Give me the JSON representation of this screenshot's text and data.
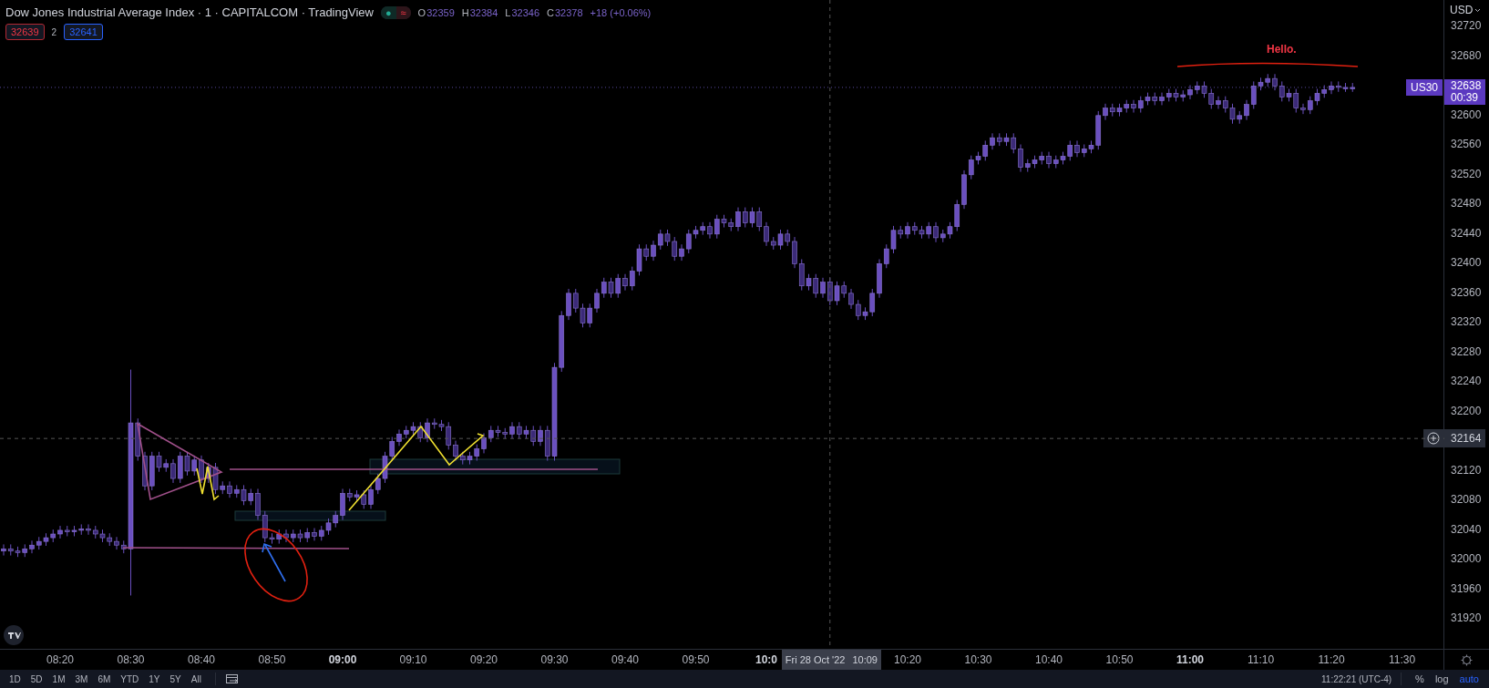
{
  "legend": {
    "title": "Dow Jones Industrial Average Index · 1 · CAPITALCOM · TradingView",
    "status_dot": "●",
    "status_glyph": "≈",
    "ohlc": [
      {
        "key": "O",
        "value": "32359"
      },
      {
        "key": "H",
        "value": "32384"
      },
      {
        "key": "L",
        "value": "32346"
      },
      {
        "key": "C",
        "value": "32378"
      }
    ],
    "change": "+18 (+0.06%)",
    "sell": "32639",
    "spread": "2",
    "buy": "32641"
  },
  "chart": {
    "currency": "USD",
    "chart_data": {
      "type": "candlestick",
      "categories": [
        null,
        null,
        null,
        null,
        null,
        null,
        null,
        null,
        "08:20",
        null,
        null,
        null,
        null,
        null,
        null,
        null,
        null,
        null,
        "08:30",
        null,
        null,
        null,
        null,
        null,
        null,
        null,
        null,
        null,
        "08:40",
        null,
        null,
        null,
        null,
        null,
        null,
        null,
        null,
        null,
        "08:50",
        null,
        null,
        null,
        null,
        null,
        null,
        null,
        null,
        null,
        "09:00",
        null,
        null,
        null,
        null,
        null,
        null,
        null,
        null,
        null,
        "09:10",
        null,
        null,
        null,
        null,
        null,
        null,
        null,
        null,
        null,
        "09:20",
        null,
        null,
        null,
        null,
        null,
        null,
        null,
        null,
        null,
        "09:30",
        null,
        null,
        null,
        null,
        null,
        null,
        null,
        null,
        null,
        "09:40",
        null,
        null,
        null,
        null,
        null,
        null,
        null,
        null,
        null,
        "09:50",
        null,
        null,
        null,
        null,
        null,
        null,
        null,
        null,
        null,
        "10:0",
        null,
        null,
        null,
        null,
        null,
        null,
        null,
        null,
        null,
        null,
        null,
        null,
        null,
        null,
        null,
        null,
        null,
        null,
        null,
        "10:20",
        null,
        null,
        null,
        null,
        null,
        null,
        null,
        null,
        null,
        "10:30",
        null,
        null,
        null,
        null,
        null,
        null,
        null,
        null,
        null,
        "10:40",
        null,
        null,
        null,
        null,
        null,
        null,
        null,
        null,
        null,
        "10:50",
        null,
        null,
        null,
        null,
        null,
        null,
        null,
        null,
        null,
        "11:00",
        null,
        null,
        null,
        null,
        null,
        null,
        null,
        null,
        null,
        "11:10",
        null,
        null,
        null,
        null,
        null,
        null,
        null,
        null,
        null,
        "11:20",
        null,
        null,
        null,
        null,
        null,
        null,
        null,
        null,
        null,
        "11:30"
      ],
      "ohlc": [
        [
          32012,
          32021,
          32006,
          32015
        ],
        [
          32015,
          32021,
          32006,
          32012
        ],
        [
          32012,
          32018,
          32004,
          32010
        ],
        [
          32010,
          32021,
          32004,
          32015
        ],
        [
          32015,
          32026,
          32009,
          32020
        ],
        [
          32020,
          32031,
          32014,
          32025
        ],
        [
          32025,
          32036,
          32019,
          32030
        ],
        [
          32030,
          32041,
          32024,
          32035
        ],
        [
          32035,
          32046,
          32029,
          32040
        ],
        [
          32040,
          32046,
          32032,
          32038
        ],
        [
          32038,
          32046,
          32032,
          32040
        ],
        [
          32040,
          32048,
          32034,
          32042
        ],
        [
          32042,
          32048,
          32034,
          32040
        ],
        [
          32040,
          32046,
          32029,
          32035
        ],
        [
          32035,
          32041,
          32024,
          32030
        ],
        [
          32030,
          32036,
          32019,
          32025
        ],
        [
          32025,
          32031,
          32014,
          32020
        ],
        [
          32020,
          32026,
          32009,
          32015
        ],
        [
          32015,
          32257,
          31952,
          32185
        ],
        [
          32185,
          32191,
          32134,
          32140
        ],
        [
          32140,
          32146,
          32094,
          32100
        ],
        [
          32100,
          32146,
          32094,
          32140
        ],
        [
          32140,
          32146,
          32119,
          32125
        ],
        [
          32125,
          32136,
          32119,
          32130
        ],
        [
          32130,
          32136,
          32104,
          32110
        ],
        [
          32110,
          32146,
          32104,
          32140
        ],
        [
          32140,
          32146,
          32114,
          32120
        ],
        [
          32120,
          32141,
          32114,
          32135
        ],
        [
          32135,
          32141,
          32104,
          32110
        ],
        [
          32110,
          32131,
          32104,
          32125
        ],
        [
          32125,
          32131,
          32089,
          32095
        ],
        [
          32095,
          32106,
          32089,
          32100
        ],
        [
          32100,
          32106,
          32084,
          32090
        ],
        [
          32090,
          32101,
          32084,
          32095
        ],
        [
          32095,
          32101,
          32074,
          32080
        ],
        [
          32080,
          32096,
          32074,
          32090
        ],
        [
          32090,
          32096,
          32054,
          32060
        ],
        [
          32060,
          32066,
          32024,
          32030
        ],
        [
          32030,
          32036,
          32022,
          32028
        ],
        [
          32028,
          32041,
          32022,
          32035
        ],
        [
          32035,
          32041,
          32024,
          32030
        ],
        [
          32030,
          32041,
          32024,
          32035
        ],
        [
          32035,
          32041,
          32024,
          32030
        ],
        [
          32030,
          32043,
          32024,
          32037
        ],
        [
          32037,
          32043,
          32026,
          32032
        ],
        [
          32032,
          32046,
          32026,
          32040
        ],
        [
          32040,
          32056,
          32034,
          32050
        ],
        [
          32050,
          32066,
          32044,
          32060
        ],
        [
          32060,
          32096,
          32054,
          32090
        ],
        [
          32090,
          32096,
          32079,
          32085
        ],
        [
          32085,
          32094,
          32079,
          32088
        ],
        [
          32088,
          32094,
          32069,
          32075
        ],
        [
          32075,
          32101,
          32069,
          32095
        ],
        [
          32095,
          32116,
          32089,
          32110
        ],
        [
          32110,
          32146,
          32104,
          32140
        ],
        [
          32140,
          32166,
          32134,
          32160
        ],
        [
          32160,
          32176,
          32154,
          32170
        ],
        [
          32170,
          32181,
          32164,
          32175
        ],
        [
          32175,
          32186,
          32169,
          32180
        ],
        [
          32180,
          32186,
          32159,
          32165
        ],
        [
          32165,
          32191,
          32159,
          32185
        ],
        [
          32185,
          32191,
          32177,
          32183
        ],
        [
          32183,
          32189,
          32174,
          32180
        ],
        [
          32180,
          32186,
          32149,
          32155
        ],
        [
          32155,
          32161,
          32134,
          32140
        ],
        [
          32140,
          32146,
          32129,
          32135
        ],
        [
          32135,
          32146,
          32129,
          32140
        ],
        [
          32140,
          32156,
          32134,
          32150
        ],
        [
          32150,
          32171,
          32144,
          32165
        ],
        [
          32165,
          32181,
          32159,
          32175
        ],
        [
          32175,
          32181,
          32166,
          32172
        ],
        [
          32172,
          32178,
          32164,
          32170
        ],
        [
          32170,
          32186,
          32164,
          32180
        ],
        [
          32180,
          32186,
          32164,
          32170
        ],
        [
          32170,
          32181,
          32164,
          32175
        ],
        [
          32175,
          32181,
          32154,
          32160
        ],
        [
          32160,
          32181,
          32154,
          32175
        ],
        [
          32175,
          32181,
          32134,
          32140
        ],
        [
          32140,
          32266,
          32134,
          32260
        ],
        [
          32260,
          32336,
          32254,
          32330
        ],
        [
          32330,
          32366,
          32324,
          32360
        ],
        [
          32360,
          32366,
          32334,
          32340
        ],
        [
          32340,
          32346,
          32314,
          32320
        ],
        [
          32320,
          32346,
          32314,
          32340
        ],
        [
          32340,
          32366,
          32334,
          32360
        ],
        [
          32360,
          32381,
          32354,
          32375
        ],
        [
          32375,
          32381,
          32354,
          32360
        ],
        [
          32360,
          32386,
          32354,
          32380
        ],
        [
          32380,
          32386,
          32364,
          32370
        ],
        [
          32370,
          32396,
          32364,
          32390
        ],
        [
          32390,
          32426,
          32384,
          32420
        ],
        [
          32420,
          32426,
          32404,
          32410
        ],
        [
          32410,
          32431,
          32404,
          32425
        ],
        [
          32425,
          32446,
          32419,
          32440
        ],
        [
          32440,
          32446,
          32424,
          32430
        ],
        [
          32430,
          32436,
          32404,
          32410
        ],
        [
          32410,
          32426,
          32404,
          32420
        ],
        [
          32420,
          32446,
          32414,
          32440
        ],
        [
          32440,
          32451,
          32434,
          32445
        ],
        [
          32445,
          32456,
          32439,
          32450
        ],
        [
          32450,
          32456,
          32434,
          32440
        ],
        [
          32440,
          32466,
          32434,
          32460
        ],
        [
          32460,
          32466,
          32449,
          32455
        ],
        [
          32455,
          32461,
          32444,
          32450
        ],
        [
          32450,
          32476,
          32444,
          32470
        ],
        [
          32470,
          32476,
          32449,
          32455
        ],
        [
          32455,
          32476,
          32449,
          32470
        ],
        [
          32470,
          32476,
          32444,
          32450
        ],
        [
          32450,
          32456,
          32424,
          32430
        ],
        [
          32430,
          32436,
          32419,
          32425
        ],
        [
          32425,
          32446,
          32419,
          32440
        ],
        [
          32440,
          32446,
          32424,
          32430
        ],
        [
          32430,
          32436,
          32394,
          32400
        ],
        [
          32400,
          32406,
          32364,
          32370
        ],
        [
          32370,
          32386,
          32364,
          32380
        ],
        [
          32380,
          32386,
          32354,
          32360
        ],
        [
          32360,
          32381,
          32354,
          32375
        ],
        [
          32375,
          32381,
          32344,
          32350
        ],
        [
          32350,
          32376,
          32344,
          32370
        ],
        [
          32370,
          32376,
          32354,
          32360
        ],
        [
          32360,
          32366,
          32339,
          32345
        ],
        [
          32345,
          32351,
          32324,
          32330
        ],
        [
          32330,
          32341,
          32324,
          32335
        ],
        [
          32335,
          32366,
          32329,
          32360
        ],
        [
          32360,
          32406,
          32354,
          32400
        ],
        [
          32400,
          32426,
          32394,
          32420
        ],
        [
          32420,
          32451,
          32414,
          32445
        ],
        [
          32445,
          32451,
          32434,
          32440
        ],
        [
          32440,
          32456,
          32434,
          32450
        ],
        [
          32450,
          32456,
          32439,
          32445
        ],
        [
          32445,
          32451,
          32434,
          32440
        ],
        [
          32440,
          32456,
          32434,
          32450
        ],
        [
          32450,
          32456,
          32429,
          32435
        ],
        [
          32435,
          32446,
          32429,
          32440
        ],
        [
          32440,
          32456,
          32434,
          32450
        ],
        [
          32450,
          32486,
          32444,
          32480
        ],
        [
          32480,
          32526,
          32474,
          32520
        ],
        [
          32520,
          32546,
          32514,
          32540
        ],
        [
          32540,
          32551,
          32534,
          32545
        ],
        [
          32545,
          32566,
          32539,
          32560
        ],
        [
          32560,
          32576,
          32554,
          32570
        ],
        [
          32570,
          32576,
          32559,
          32565
        ],
        [
          32565,
          32576,
          32559,
          32570
        ],
        [
          32570,
          32576,
          32549,
          32555
        ],
        [
          32555,
          32561,
          32524,
          32530
        ],
        [
          32530,
          32541,
          32524,
          32535
        ],
        [
          32535,
          32546,
          32529,
          32540
        ],
        [
          32540,
          32551,
          32534,
          32545
        ],
        [
          32545,
          32551,
          32529,
          32535
        ],
        [
          32535,
          32546,
          32529,
          32540
        ],
        [
          32540,
          32551,
          32534,
          32545
        ],
        [
          32545,
          32566,
          32539,
          32560
        ],
        [
          32560,
          32566,
          32544,
          32550
        ],
        [
          32550,
          32561,
          32544,
          32555
        ],
        [
          32555,
          32566,
          32549,
          32560
        ],
        [
          32560,
          32606,
          32554,
          32600
        ],
        [
          32600,
          32616,
          32594,
          32610
        ],
        [
          32610,
          32616,
          32599,
          32605
        ],
        [
          32605,
          32616,
          32599,
          32610
        ],
        [
          32610,
          32621,
          32604,
          32615
        ],
        [
          32615,
          32621,
          32604,
          32610
        ],
        [
          32610,
          32626,
          32604,
          32620
        ],
        [
          32620,
          32631,
          32614,
          32625
        ],
        [
          32625,
          32631,
          32614,
          32620
        ],
        [
          32620,
          32631,
          32614,
          32625
        ],
        [
          32625,
          32636,
          32619,
          32630
        ],
        [
          32630,
          32636,
          32619,
          32625
        ],
        [
          32625,
          32634,
          32619,
          32628
        ],
        [
          32628,
          32641,
          32622,
          32635
        ],
        [
          32635,
          32646,
          32629,
          32640
        ],
        [
          32640,
          32646,
          32624,
          32630
        ],
        [
          32630,
          32636,
          32609,
          32615
        ],
        [
          32615,
          32626,
          32609,
          32620
        ],
        [
          32620,
          32626,
          32604,
          32610
        ],
        [
          32610,
          32616,
          32589,
          32595
        ],
        [
          32595,
          32606,
          32589,
          32600
        ],
        [
          32600,
          32621,
          32594,
          32615
        ],
        [
          32615,
          32646,
          32609,
          32640
        ],
        [
          32640,
          32651,
          32634,
          32645
        ],
        [
          32645,
          32656,
          32639,
          32650
        ],
        [
          32650,
          32656,
          32634,
          32640
        ],
        [
          32640,
          32646,
          32619,
          32625
        ],
        [
          32625,
          32636,
          32619,
          32630
        ],
        [
          32630,
          32636,
          32604,
          32610
        ],
        [
          32610,
          32616,
          32602,
          32608
        ],
        [
          32608,
          32626,
          32602,
          32620
        ],
        [
          32620,
          32636,
          32614,
          32630
        ],
        [
          32630,
          32641,
          32624,
          32635
        ],
        [
          32635,
          32646,
          32629,
          32640
        ],
        [
          32640,
          32646,
          32632,
          32638
        ],
        [
          32638,
          32644,
          32632,
          32638
        ],
        [
          32638,
          32644,
          32632,
          32638
        ],
        null,
        null,
        null,
        null,
        null,
        null,
        null
      ],
      "ylim": [
        31880,
        32756
      ],
      "yticks": [
        31920,
        31960,
        32000,
        32040,
        32080,
        32120,
        32200,
        32240,
        32280,
        32320,
        32360,
        32400,
        32440,
        32480,
        32520,
        32560,
        32600,
        32680,
        32720
      ]
    },
    "last_price": {
      "symbol": "US30",
      "price": "32638",
      "countdown": "00:39"
    },
    "crosshair": {
      "date": "Fri 28 Oct '22",
      "time": "10:09",
      "price": "32164"
    },
    "note": "Hello."
  },
  "ranges": [
    "1D",
    "5D",
    "1M",
    "3M",
    "6M",
    "YTD",
    "1Y",
    "5Y",
    "All"
  ],
  "clock": "11:22:21 (UTC-4)",
  "scale_options": [
    {
      "label": "%",
      "selected": false
    },
    {
      "label": "log",
      "selected": false
    },
    {
      "label": "auto",
      "selected": true
    }
  ]
}
